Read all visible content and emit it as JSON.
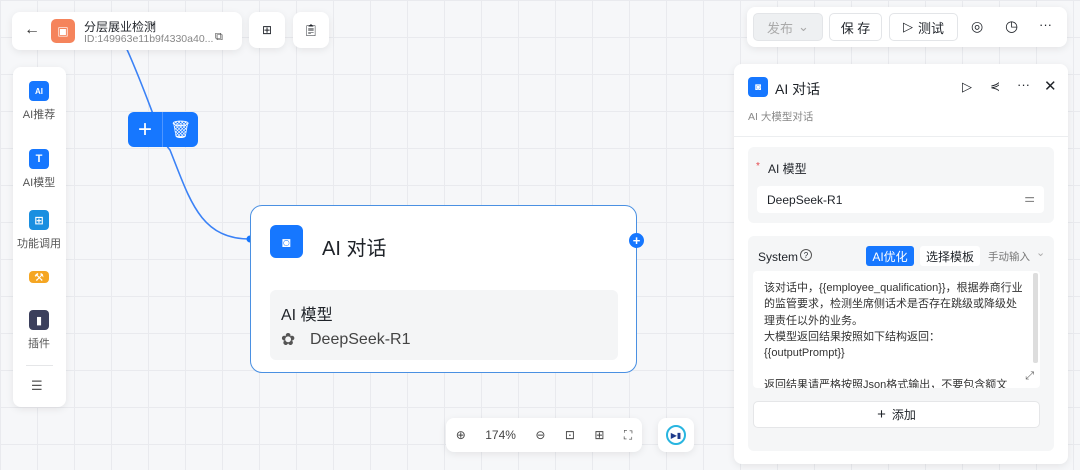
{
  "header": {
    "title": "分层展业检测",
    "id": "ID:149963e11b9f4330a40...",
    "app_icon_color": "#f5845c"
  },
  "toolbar": {
    "publish": "发布",
    "save": "保 存",
    "test": "测试"
  },
  "sidebar": {
    "items": [
      {
        "label": "AI推荐",
        "icon": "ai-badge-icon",
        "color": "#1677ff"
      },
      {
        "label": "AI模型",
        "icon": "text-t-icon",
        "color": "#1677ff"
      },
      {
        "label": "功能调用",
        "icon": "grid-apps-icon",
        "color": "#1a8fe0"
      },
      {
        "label": "",
        "icon": "wrench-icon",
        "color": "#f5a623"
      },
      {
        "label": "插件",
        "icon": "plugin-icon",
        "color": "#3b3f5c"
      }
    ]
  },
  "node_actions": {
    "add": "+",
    "delete": "delete"
  },
  "node": {
    "title": "AI 对话",
    "section_label": "AI 模型",
    "model": "DeepSeek-R1",
    "accent": "#1677ff"
  },
  "zoom": {
    "level": "174%"
  },
  "panel": {
    "title": "AI 对话",
    "subtitle": "AI 大模型对话",
    "model_label": "AI 模型",
    "required_mark": "*",
    "model_value": "DeepSeek-R1",
    "system_label": "System",
    "ai_optimize": "AI优化",
    "choose_template": "选择模板",
    "manual_input": "手动输入",
    "prompt_lines": [
      "该对话中，{{employee_qualification}}，根据券商行业的监管要求，检测坐席侧话术是否存在跳级或降级处理责任以外的业务。",
      "大模型返回结果按照如下结构返回：",
      "{{outputPrompt}}",
      "",
      "返回结果请严格按照Json格式输出，不要包含额文"
    ],
    "add_label": "添加"
  }
}
